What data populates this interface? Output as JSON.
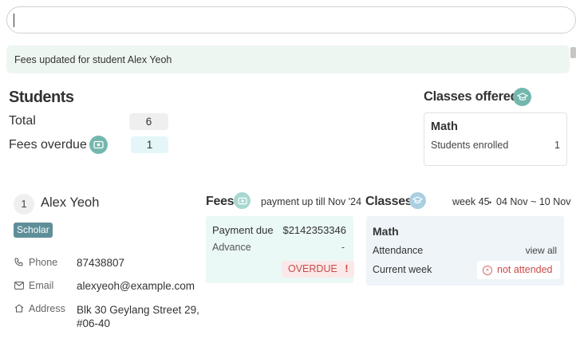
{
  "command_box": {
    "value": ""
  },
  "feedback": {
    "message": "Fees updated for student Alex Yeoh"
  },
  "summary": {
    "title": "Students",
    "total_label": "Total",
    "total_value": "6",
    "overdue_label": "Fees overdue",
    "overdue_value": "1"
  },
  "classes_offered": {
    "title": "Classes offered",
    "classes": [
      {
        "name": "Math",
        "enrolled_label": "Students enrolled",
        "enrolled_count": "1"
      }
    ]
  },
  "student": {
    "index": "1",
    "name": "Alex Yeoh",
    "tag": "Scholar",
    "phone_label": "Phone",
    "phone": "87438807",
    "email_label": "Email",
    "email": "alexyeoh@example.com",
    "address_label": "Address",
    "address_line1": "Blk 30 Geylang Street 29,",
    "address_line2": "#06-40"
  },
  "fees": {
    "title": "Fees",
    "paid_till": "payment up till Nov '24",
    "payment_due_label": "Payment due",
    "payment_due_value": "$2142353346",
    "advance_label": "Advance",
    "advance_value": "-",
    "status": "OVERDUE",
    "status_mark": "!"
  },
  "classes_detail": {
    "title": "Classes",
    "week": "week 45",
    "separator": "•",
    "date_range": "04 Nov ~ 10 Nov",
    "class_name": "Math",
    "attendance_label": "Attendance",
    "view_all": "view all",
    "current_week_label": "Current week",
    "attendance_status": "not attended"
  },
  "colors": {
    "accent": "#74b7ae",
    "tag": "#5e8f99",
    "overdue_text": "#c94a4a",
    "feedback_bg": "#eef6f1"
  },
  "icons": [
    "graduation-cap-icon",
    "money-icon",
    "phone-icon",
    "mail-icon",
    "home-icon",
    "x-circle-icon"
  ]
}
